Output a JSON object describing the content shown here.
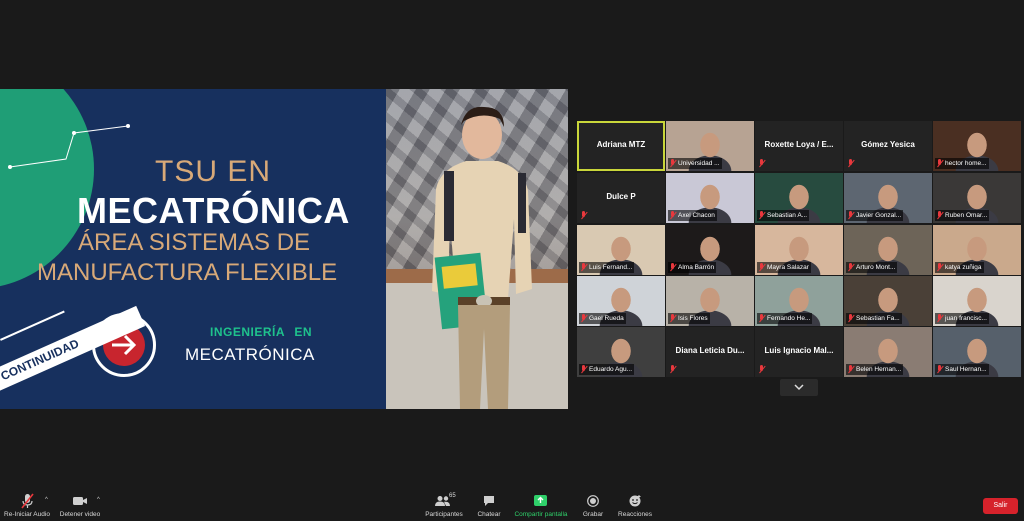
{
  "slide": {
    "line1": "TSU EN",
    "line2": "MECATRÓNICA",
    "line3": "ÁREA SISTEMAS DE",
    "line4": "MANUFACTURA FLEXIBLE",
    "ingenieria": "INGENIERÍA EN",
    "mecatronica": "MECATRÓNICA",
    "continuidad": "CONTINUIDAD",
    "colors": {
      "navy": "#17305e",
      "green": "#1f9e76",
      "gold": "#d8a978",
      "red": "#c8252e"
    }
  },
  "gallery": {
    "tiles": [
      {
        "name": "Adriana MTZ",
        "video": false,
        "active": true
      },
      {
        "name": "Universidad ...",
        "video": true,
        "muted": true,
        "bg": "#b7a393"
      },
      {
        "name": "Roxette Loya / E...",
        "video": false,
        "muted": true
      },
      {
        "name": "Gómez Yesica",
        "video": false,
        "muted": true
      },
      {
        "name": "hector home...",
        "video": true,
        "muted": true,
        "bg": "#4a2f22"
      },
      {
        "name": "Dulce P",
        "video": false,
        "muted": true
      },
      {
        "name": "Axel Chacon",
        "video": true,
        "muted": true,
        "bg": "#c9c8d6"
      },
      {
        "name": "Sebastian A...",
        "video": true,
        "muted": true,
        "bg": "#274b3f"
      },
      {
        "name": "Javier Gonzal...",
        "video": true,
        "muted": true,
        "bg": "#5d6671"
      },
      {
        "name": "Ruben Omar...",
        "video": true,
        "muted": true,
        "bg": "#3a3837"
      },
      {
        "name": "Luis Fernand...",
        "video": true,
        "muted": true,
        "bg": "#d9c9b2"
      },
      {
        "name": "Alma Barrón",
        "video": true,
        "muted": true,
        "bg": "#1d1a1a"
      },
      {
        "name": "Mayra Salazar",
        "video": true,
        "muted": true,
        "bg": "#d7b79d"
      },
      {
        "name": "Arturo Mont...",
        "video": true,
        "muted": true,
        "bg": "#6d6458"
      },
      {
        "name": "katya zuñiga",
        "video": true,
        "muted": true,
        "bg": "#caa98c"
      },
      {
        "name": "Gael Rueda",
        "video": true,
        "muted": true,
        "bg": "#cfd3d8"
      },
      {
        "name": "Isis Flores",
        "video": true,
        "muted": true,
        "bg": "#b8b2a8"
      },
      {
        "name": "Fernando He...",
        "video": true,
        "muted": true,
        "bg": "#8fa19b"
      },
      {
        "name": "Sebastian Fa...",
        "video": true,
        "muted": true,
        "bg": "#4a4037"
      },
      {
        "name": "juan francisc...",
        "video": true,
        "muted": true,
        "bg": "#d9d4cd"
      },
      {
        "name": "Eduardo Agu...",
        "video": true,
        "muted": true,
        "bg": "#3f3f3f"
      },
      {
        "name": "Diana Leticia Du...",
        "video": false,
        "muted": true
      },
      {
        "name": "Luis Ignacio Mal...",
        "video": false,
        "muted": true
      },
      {
        "name": "Belen Hernan...",
        "video": true,
        "muted": true,
        "bg": "#8a7c73"
      },
      {
        "name": "Saul Hernan...",
        "video": true,
        "muted": true,
        "bg": "#56606b"
      }
    ]
  },
  "toolbar": {
    "audio_label": "Re-Iniciar Audio",
    "video_label": "Detener video",
    "participants_label": "Participantes",
    "participants_count": "65",
    "chat_label": "Chatear",
    "share_label": "Compartir pantalla",
    "record_label": "Grabar",
    "reactions_label": "Reacciones",
    "leave_label": "Salir"
  }
}
